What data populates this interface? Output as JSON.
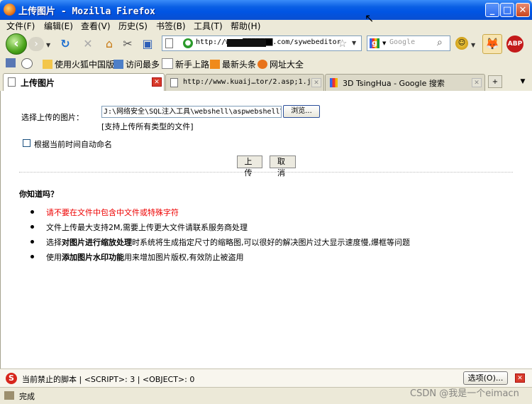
{
  "window": {
    "title": "上传图片 - Mozilla Firefox"
  },
  "menu": [
    "文件(F)",
    "编辑(E)",
    "查看(V)",
    "历史(S)",
    "书签(B)",
    "工具(T)",
    "帮助(H)"
  ],
  "nav": {
    "url": "http://www.███████.com/sywebeditor",
    "search_placeholder": "Google"
  },
  "bookmarks": [
    "使用火狐中国版",
    "访问最多",
    "新手上路",
    "最新头条",
    "网址大全"
  ],
  "tabs": [
    {
      "label": "上传图片",
      "active": true
    },
    {
      "label": "http://www.kuaij…tor/2.asp;1.jpg",
      "active": false
    },
    {
      "label": "3D TsingHua - Google 搜索",
      "active": false
    }
  ],
  "upload": {
    "choose_label": "选择上传的图片：",
    "file_path": "J:\\网络安全\\SQL注入工具\\webshell\\aspwebshell\\2",
    "browse_label": "浏览...",
    "support_text": "[支持上传所有类型的文件]",
    "auto_name_label": "根据当前时间自动命名",
    "auto_name_checked": false,
    "upload_button": "上 传",
    "cancel_button": "取 消"
  },
  "tips": {
    "heading": "你知道吗？",
    "items": [
      {
        "pre": "请不要在文件中包含中文件或特殊字符",
        "bold": "",
        "post": "",
        "color": "#e00000"
      },
      {
        "pre": "文件上传最大支持2M,需要上传更大文件请联系服务商处理",
        "bold": "",
        "post": "",
        "color": "#000000"
      },
      {
        "pre": "选择",
        "bold": "对图片进行缩放处理",
        "post": "时系统将生成指定尺寸的缩略图,可以很好的解决图片过大显示速度慢,爆框等问题",
        "color": "#000000"
      },
      {
        "pre": "使用",
        "bold": "添加图片水印功能",
        "post": "用来增加图片版权,有效防止被盗用",
        "color": "#000000"
      }
    ]
  },
  "scriptbar": {
    "text": "当前禁止的脚本 | <SCRIPT>: 3 | <OBJECT>: 0",
    "options_button": "选项(O)..."
  },
  "status": {
    "text": "完成",
    "watermark": "CSDN @我是一个eimacn"
  }
}
